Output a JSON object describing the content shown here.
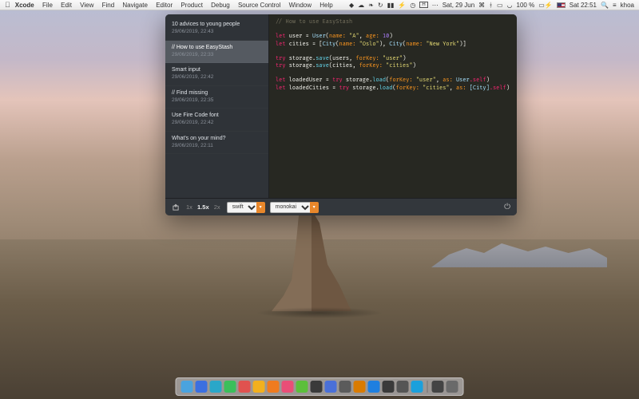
{
  "menubar": {
    "app_name": "Xcode",
    "menus": [
      "File",
      "Edit",
      "View",
      "Find",
      "Navigate",
      "Editor",
      "Product",
      "Debug",
      "Source Control",
      "Window",
      "Help"
    ],
    "date": "Sat, 29 Jun",
    "battery_pct": "100 %",
    "time": "Sat 22:51",
    "user": "khoa"
  },
  "window": {
    "notes": [
      {
        "title": "10 advices to young people",
        "date": "29/06/2019, 22:43",
        "selected": false
      },
      {
        "title": "// How to use EasyStash",
        "date": "29/06/2019, 22:33",
        "selected": true
      },
      {
        "title": "Smart input",
        "date": "29/06/2019, 22:42",
        "selected": false
      },
      {
        "title": "// Find missing",
        "date": "29/06/2019, 22:35",
        "selected": false
      },
      {
        "title": "Use Fire Code font",
        "date": "29/06/2019, 22:42",
        "selected": false
      },
      {
        "title": "What's on your mind?",
        "date": "29/06/2019, 22:11",
        "selected": false
      }
    ],
    "editor": {
      "comment": "// How to use EasyStash",
      "l2_let": "let",
      "l2_user": "user =",
      "l2_type": "User",
      "l2_p1": "name:",
      "l2_s1": "\"A\"",
      "l2_c": ",",
      "l2_p2": "age:",
      "l2_n": "10",
      "l2_end": ")",
      "l3_let": "let",
      "l3_cities": "cities = [",
      "l3_t1": "City",
      "l3_p1": "name:",
      "l3_s1": "\"Oslo\"",
      "l3_c": "),",
      "l3_t2": "City",
      "l3_p2": "name:",
      "l3_s2": "\"New York\"",
      "l3_end": ")]",
      "l5_try": "try",
      "l5_rest": "storage.",
      "l5_call": "save",
      "l5_args": "(users, ",
      "l5_p": "forKey:",
      "l5_s": "\"user\"",
      "l5_end": ")",
      "l6_try": "try",
      "l6_rest": "storage.",
      "l6_call": "save",
      "l6_args": "(cities, ",
      "l6_p": "forKey:",
      "l6_s": "\"cities\"",
      "l6_end": ")",
      "l8_let": "let",
      "l8_id": "loadedUser =",
      "l8_try": "try",
      "l8_rest": "storage.",
      "l8_call": "load",
      "l8_p1": "forKey:",
      "l8_s1": "\"user\"",
      "l8_c": ", ",
      "l8_p2": "as:",
      "l8_t": "User",
      "l8_self": ".self",
      "l8_end": ")",
      "l9_let": "let",
      "l9_id": "loadedCities =",
      "l9_try": "try",
      "l9_rest": "storage.",
      "l9_call": "load",
      "l9_p1": "forKey:",
      "l9_s1": "\"cities\"",
      "l9_c": ", ",
      "l9_p2": "as:",
      "l9_t": "[City]",
      "l9_self": ".self",
      "l9_end": ")"
    },
    "toolbar": {
      "zoom_levels": [
        "1x",
        "1.5x",
        "2x"
      ],
      "zoom_active": "1.5x",
      "language_select": "swift",
      "theme_select": "monokai"
    }
  },
  "dock_colors": [
    "#4aa3df",
    "#3b6fe0",
    "#2aa7c9",
    "#3bbf5b",
    "#e0524f",
    "#f2b01e",
    "#f07b1f",
    "#e94e77",
    "#5cbf3b",
    "#3a3a3a",
    "#4a70d8",
    "#5b5b5b",
    "#d97b00",
    "#1e7fe0",
    "#3a3a3a",
    "#555",
    "#1ba0dc",
    "#444",
    "#6a6a6a"
  ]
}
